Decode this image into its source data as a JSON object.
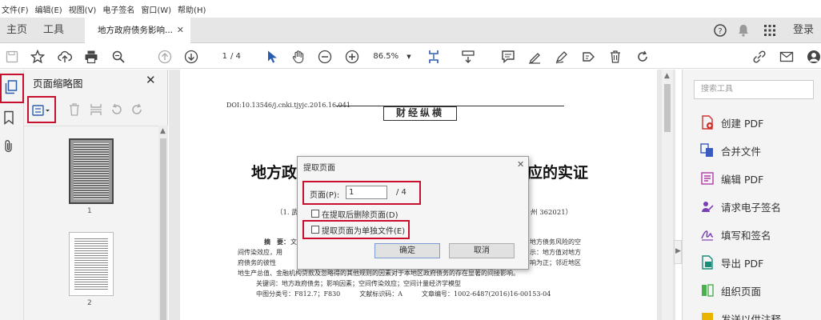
{
  "menu": [
    "文件(F)",
    "编辑(E)",
    "视图(V)",
    "电子签名",
    "窗口(W)",
    "帮助(H)"
  ],
  "tabs": {
    "home": "主页",
    "tools": "工具",
    "document": "地方政府债务影响..."
  },
  "account": {
    "login": "登录"
  },
  "toolbar": {
    "page_current": "1",
    "page_total": "/ 4",
    "zoom": "86.5%"
  },
  "thumbnails": {
    "title": "页面缩略图",
    "pages": [
      "1",
      "2"
    ]
  },
  "document": {
    "doi": "DOI:10.13546/j.cnki.tjyjc.2016.16.041",
    "column_banner": "财经纵横",
    "title_left": "地方政",
    "title_right": "应的实证",
    "affil_left": "（1. 武",
    "affil_right": "州 362021）",
    "abstract_label": "摘　要：",
    "abstract_l1a": "文",
    "abstract_l1b": "地方债务风险的空",
    "abstract_l2a": "间传染效应，用",
    "abstract_l2b": "示：地方值对地方",
    "abstract_l3a": "府债务的彼性",
    "abstract_l3b": "响为正；邻近地区",
    "abstract_l4": "地生产总值、金融机构贷款及忽略得的其他规则的因素对于本地区政府债务的存在显著的间接影响。",
    "keywords": "关键词：地方政府债务；影响因素；空间传染效应；空间计量经济学模型",
    "classification": "中图分类号：F812.7；F830　　　文献标识码：A　　　文章编号：1002-6487(2016)16-00153-04"
  },
  "dialog": {
    "title": "提取页面",
    "page_label": "页面(P):",
    "page_value": "1",
    "page_total": "/ 4",
    "delete_option": "在提取后删除页面(D)",
    "separate_option": "提取页面为单独文件(E)",
    "ok": "确定",
    "cancel": "取消"
  },
  "right_panel": {
    "search_placeholder": "搜索工具",
    "tools": [
      "创建 PDF",
      "合并文件",
      "编辑 PDF",
      "请求电子签名",
      "填写和签名",
      "导出 PDF",
      "组织页面",
      "发送以供注释"
    ]
  },
  "colors": {
    "accent_red": "#c8102e",
    "tool_blue": "#2a5db0",
    "pdf_red": "#d0312d"
  }
}
